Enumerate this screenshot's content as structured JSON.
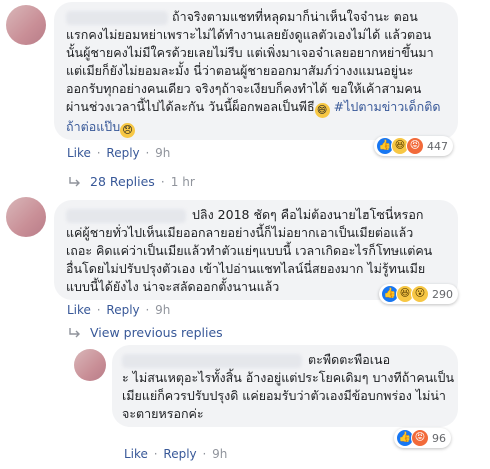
{
  "comment1": {
    "text_lines": [
      "ถ้าจริงตามแชทที่หลุดมาก็น่าเห็นใจจ๋านะ ตอน",
      "แรกคงไม่ยอมหย่าเพราะไม่ได้ทำงานเลยยังดูแลตัวเองไม่ได้ แล้วตอน",
      "นั้นผู้ชายคงไม่มีใครด้วยเลยไม่รีบ แต่เพิ่งมาเจอจ๋าเลยอยากหย่าขึ้นมา",
      "แต่เมียก็ยังไม่ยอมละมั้ง นี่ว่าตอนผู้ชายออกมาสัมภ์ว่างงแมนอยู่นะ",
      "ออกรับทุกอย่างคนเดียว จริงๆถ้าจะเงียบก็คงทำได้ ขอให้เค้าสามคน",
      "ผ่านช่วงเวลานี้ไปได้ละกัน วันนี้ผ็อกพอลเป็นพีธี"
    ],
    "hashtag": "#ไปตามข่าวเด็กติด",
    "last_line": "ถ้าต่อแป๊บ",
    "like_label": "Like",
    "reply_label": "Reply",
    "time": "9h",
    "reaction_count": "447"
  },
  "replies_link": {
    "label": "28 Replies",
    "time": "1 hr"
  },
  "comment2": {
    "text_lines": [
      "ปลิง 2018 ชัดๆ คือไม่ต้องนายไฮโซนี่หรอก",
      "แค่ผู้ชายทั่วไปเห็นเมียออกลายอย่างนี้ก็ไม่อยากเอาเป็นเมียต่อแล้ว",
      "เถอะ คิดแค่ว่าเป็นเมียแล้วทำตัวแย่ๆแบบนี้ เวลาเกิดอะไรก็โทษแต่คน",
      "อื่นโดยไม่ปรับปรุงตัวเอง เข้าไปอ่านแชทไลน์นี่สยองมาก ไม่รู้ทนเมีย",
      "แบบนี้ได้ยังไง น่าจะสลัดออกตั้งนานแล้ว"
    ],
    "like_label": "Like",
    "reply_label": "Reply",
    "time": "9h",
    "reaction_count": "290"
  },
  "view_previous": {
    "label": "View previous replies"
  },
  "reply1": {
    "text_lines": [
      "ตะพืดตะพือเนอ",
      "ะ ไม่สนเหตุอะไรทั้งสิ้น อ้างอยู่แต่ประโยคเดิมๆ บางทีถ้าคนเป็น",
      "เมียแย่ก็ควรปรับปรุงดิ แค่ยอมรับว่าตัวเองมีข้อบกพร่อง ไม่น่า",
      "จะตายหรอกค่ะ"
    ],
    "like_label": "Like",
    "reply_label": "Reply",
    "time": "9h",
    "reaction_count": "96"
  }
}
